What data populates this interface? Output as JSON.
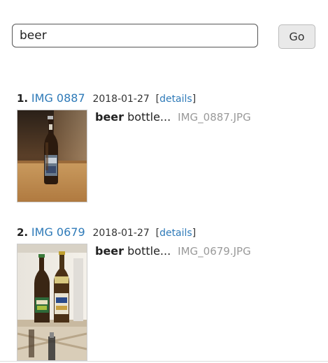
{
  "search": {
    "value": "beer",
    "button_label": "Go"
  },
  "results": [
    {
      "number": "1.",
      "title": "IMG 0887",
      "date": "2018-01-27",
      "details_open": "[",
      "details_label": "details",
      "details_close": "]",
      "snippet_bold": "beer",
      "snippet_rest": " bottle...",
      "filename": "IMG_0887.JPG",
      "thumbnail": "photo-single-beer-bottle-on-table"
    },
    {
      "number": "2.",
      "title": "IMG 0679",
      "date": "2018-01-27",
      "details_open": "[",
      "details_label": "details",
      "details_close": "]",
      "snippet_bold": "beer",
      "snippet_rest": " bottle...",
      "filename": "IMG_0679.JPG",
      "thumbnail": "photo-two-beer-bottles-in-fridge"
    }
  ],
  "colors": {
    "link": "#2e7ab8",
    "filename": "#9a9a9a"
  }
}
